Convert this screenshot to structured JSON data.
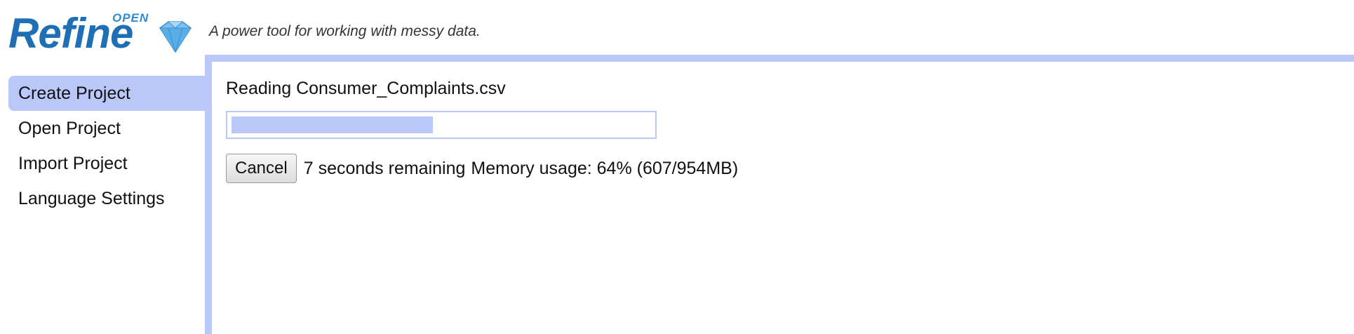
{
  "header": {
    "logo_small_text": "OPEN",
    "logo_main_text": "Refine",
    "tagline": "A power tool for working with messy data."
  },
  "sidebar": {
    "items": [
      {
        "label": "Create Project",
        "active": true
      },
      {
        "label": "Open Project",
        "active": false
      },
      {
        "label": "Import Project",
        "active": false
      },
      {
        "label": "Language Settings",
        "active": false
      }
    ]
  },
  "main": {
    "reading_text": "Reading Consumer_Complaints.csv",
    "progress_fraction": 0.48,
    "cancel_label": "Cancel",
    "time_remaining": "7 seconds remaining",
    "memory_usage": "Memory usage: 64% (607/954MB)"
  },
  "colors": {
    "accent": "#b9c8f9",
    "logo_blue": "#1f6fb6",
    "logo_light_blue": "#2e8bd6"
  },
  "icons": {
    "logo_gem": "diamond-icon"
  }
}
